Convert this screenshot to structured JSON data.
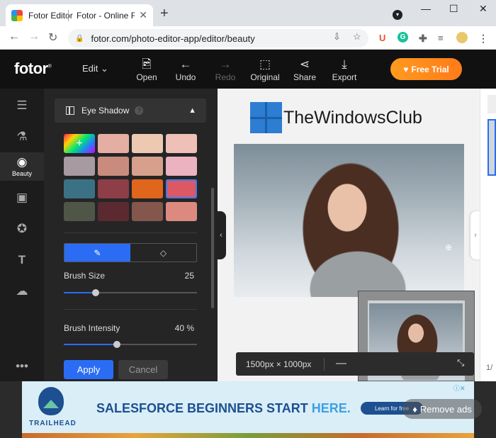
{
  "browser": {
    "tabs": [
      {
        "title": "Fotor Editor"
      },
      {
        "title": "Fotor - Online Fo"
      }
    ],
    "url": "fotor.com/photo-editor-app/editor/beauty",
    "ext_u": "U",
    "ext_g": "G"
  },
  "app": {
    "logo": "fotor",
    "logo_mark": "®",
    "edit_menu": "Edit",
    "tools": [
      {
        "label": "Open",
        "icon": "image-plus-icon"
      },
      {
        "label": "Undo",
        "icon": "arrow-left-icon"
      },
      {
        "label": "Redo",
        "icon": "arrow-right-icon"
      },
      {
        "label": "Original",
        "icon": "image-icon"
      },
      {
        "label": "Share",
        "icon": "share-icon"
      },
      {
        "label": "Export",
        "icon": "download-icon"
      }
    ],
    "free_trial": "Free Trial"
  },
  "rail": {
    "beauty_label": "Beauty"
  },
  "panel": {
    "title": "Eye Shadow",
    "help": "?",
    "swatches": [
      "rainbow",
      "#e5aea2",
      "#eec9b1",
      "#efc0b8",
      "#a89aa1",
      "#c98c7c",
      "#d6a08c",
      "#ebb2bf",
      "#3b7185",
      "#8d3e46",
      "#e0651d",
      "#dc5865",
      "#4f5647",
      "#5b2a30",
      "#84564c",
      "#dc8a80"
    ],
    "selected_swatch": 11,
    "brush_size_label": "Brush Size",
    "brush_size_value": "25",
    "brush_size_fraction": 0.24,
    "brush_intensity_label": "Brush Intensity",
    "brush_intensity_value": "40 %",
    "brush_intensity_fraction": 0.4,
    "apply": "Apply",
    "cancel": "Cancel"
  },
  "canvas": {
    "watermark": "TheWindowsClub",
    "dimensions": "1500px × 1000px",
    "zoom_minus": "—",
    "page_count": "1/"
  },
  "ad": {
    "brand": "TRAILHEAD",
    "headline_main": "SALESFORCE BEGINNERS START ",
    "headline_highlight": "HERE.",
    "cta": "Learn for free",
    "remove": "Remove ads"
  }
}
